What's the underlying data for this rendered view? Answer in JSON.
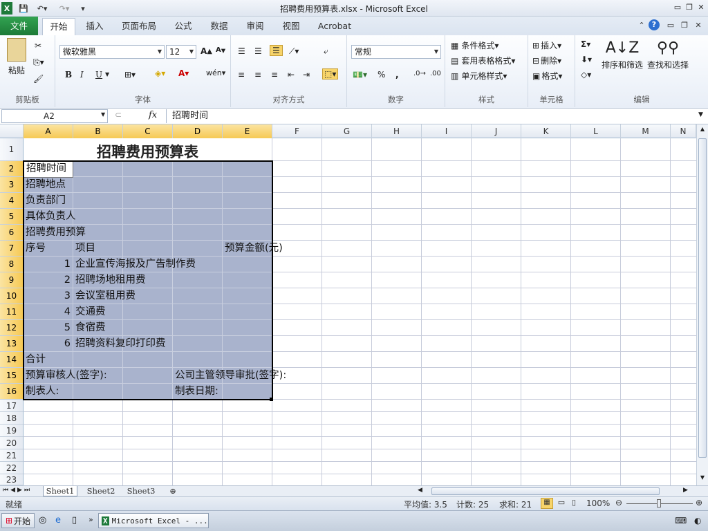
{
  "window": {
    "title": "招聘费用预算表.xlsx - Microsoft Excel"
  },
  "tabs": [
    "文件",
    "开始",
    "插入",
    "页面布局",
    "公式",
    "数据",
    "审阅",
    "视图",
    "Acrobat"
  ],
  "ribbon": {
    "clipboard": {
      "name": "剪贴板",
      "paste": "粘贴"
    },
    "font": {
      "name": "字体",
      "family": "微软雅黑",
      "size": "12",
      "bold": "B",
      "italic": "I",
      "underline": "U"
    },
    "alignment": {
      "name": "对齐方式"
    },
    "number": {
      "name": "数字",
      "format": "常规",
      "percent": "%",
      "comma": ","
    },
    "styles": {
      "name": "样式",
      "conditional": "条件格式",
      "table": "套用表格格式",
      "cell": "单元格样式"
    },
    "cells": {
      "name": "单元格",
      "insert": "插入",
      "delete": "删除",
      "format": "格式"
    },
    "editing": {
      "name": "编辑",
      "sortfilter": "排序和筛选",
      "findselect": "查找和选择",
      "sigma": "Σ"
    }
  },
  "formula": {
    "namebox": "A2",
    "fx": "fx",
    "content": "招聘时间"
  },
  "columns": [
    "A",
    "B",
    "C",
    "D",
    "E",
    "F",
    "G",
    "H",
    "I",
    "J",
    "K",
    "L",
    "M",
    "N"
  ],
  "rows": [
    "1",
    "2",
    "3",
    "4",
    "5",
    "6",
    "7",
    "8",
    "9",
    "10",
    "11",
    "12",
    "13",
    "14",
    "15",
    "16",
    "17",
    "18",
    "19",
    "20",
    "21",
    "22",
    "23"
  ],
  "sheet": {
    "title": "招聘费用预算表",
    "a2": "招聘时间",
    "a3": "招聘地点",
    "a4": "负责部门",
    "a5": "具体负责人",
    "a6": "招聘费用预算",
    "a7": "序号",
    "b7": "项目",
    "e7": "预算金额(元)",
    "items": [
      {
        "no": "1",
        "name": "企业宣传海报及广告制作费"
      },
      {
        "no": "2",
        "name": "招聘场地租用费"
      },
      {
        "no": "3",
        "name": "会议室租用费"
      },
      {
        "no": "4",
        "name": "交通费"
      },
      {
        "no": "5",
        "name": "食宿费"
      },
      {
        "no": "6",
        "name": "招聘资料复印打印费"
      }
    ],
    "a14": "合计",
    "a15": "预算审核人(签字):",
    "d15": "公司主管领导审批(签字):",
    "a16": "制表人:",
    "d16": "制表日期:"
  },
  "sheettabs": [
    "Sheet1",
    "Sheet2",
    "Sheet3"
  ],
  "status": {
    "ready": "就绪",
    "avg": "平均值: 3.5",
    "count": "计数: 25",
    "sum": "求和: 21",
    "zoom": "100%"
  },
  "taskbar": {
    "start": "开始",
    "app": "Microsoft Excel - ..."
  }
}
